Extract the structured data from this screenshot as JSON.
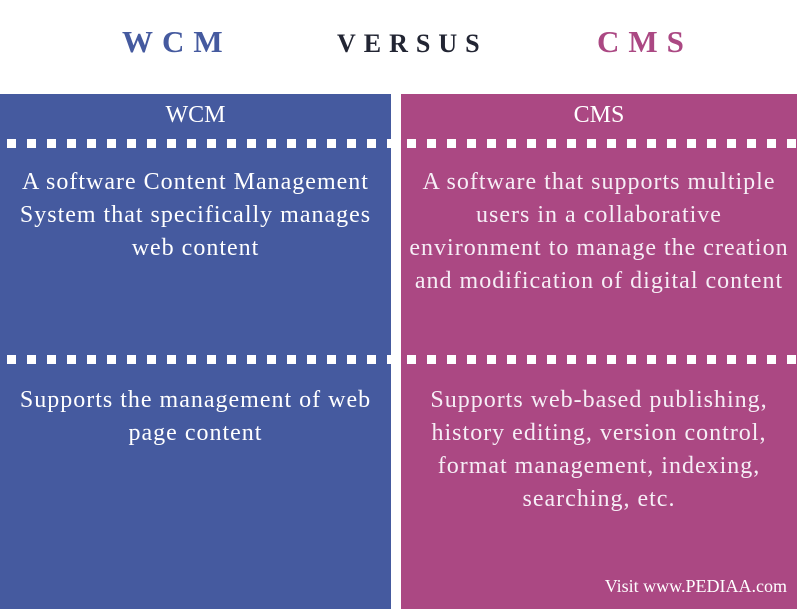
{
  "header": {
    "left_title": "WCM",
    "middle_title": "VERSUS",
    "right_title": "CMS"
  },
  "colors": {
    "wcm": "#455a9f",
    "cms": "#ab4883",
    "versus": "#222533"
  },
  "columns": [
    {
      "heading": "WCM",
      "rows": [
        "A software Content Management System that specifically manages web content",
        "Supports the management of web page content"
      ]
    },
    {
      "heading": "CMS",
      "rows": [
        "A software that supports multiple users in a collaborative environment to manage the creation and modification of digital content",
        "Supports web-based publishing, history editing, version control, format management, indexing, searching, etc."
      ]
    }
  ],
  "footer": {
    "credit": "Visit www.PEDIAA.com"
  }
}
